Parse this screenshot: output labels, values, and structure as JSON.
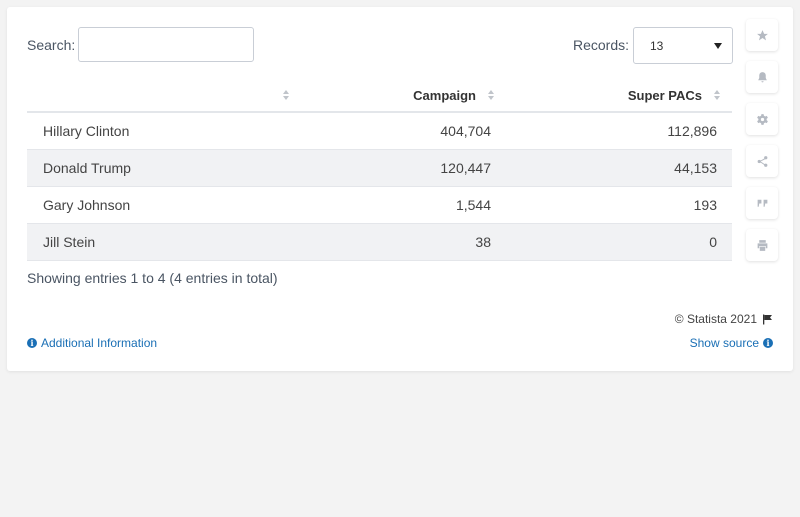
{
  "search": {
    "label": "Search:",
    "value": ""
  },
  "records": {
    "label": "Records:",
    "value": "13"
  },
  "table": {
    "headers": [
      "",
      "Campaign",
      "Super PACs"
    ],
    "rows": [
      [
        "Hillary Clinton",
        "404,704",
        "112,896"
      ],
      [
        "Donald Trump",
        "120,447",
        "44,153"
      ],
      [
        "Gary Johnson",
        "1,544",
        "193"
      ],
      [
        "Jill Stein",
        "38",
        "0"
      ]
    ]
  },
  "footer": {
    "showing": "Showing entries 1 to 4 (4 entries in total)",
    "credit": "© Statista 2021",
    "additional_info": "Additional Information",
    "show_source": "Show source"
  },
  "sidebar_icons": [
    "star-icon",
    "bell-icon",
    "gear-icon",
    "share-icon",
    "quote-icon",
    "print-icon"
  ],
  "colors": {
    "link": "#1a6fb5",
    "row_alt": "#f1f2f4"
  }
}
